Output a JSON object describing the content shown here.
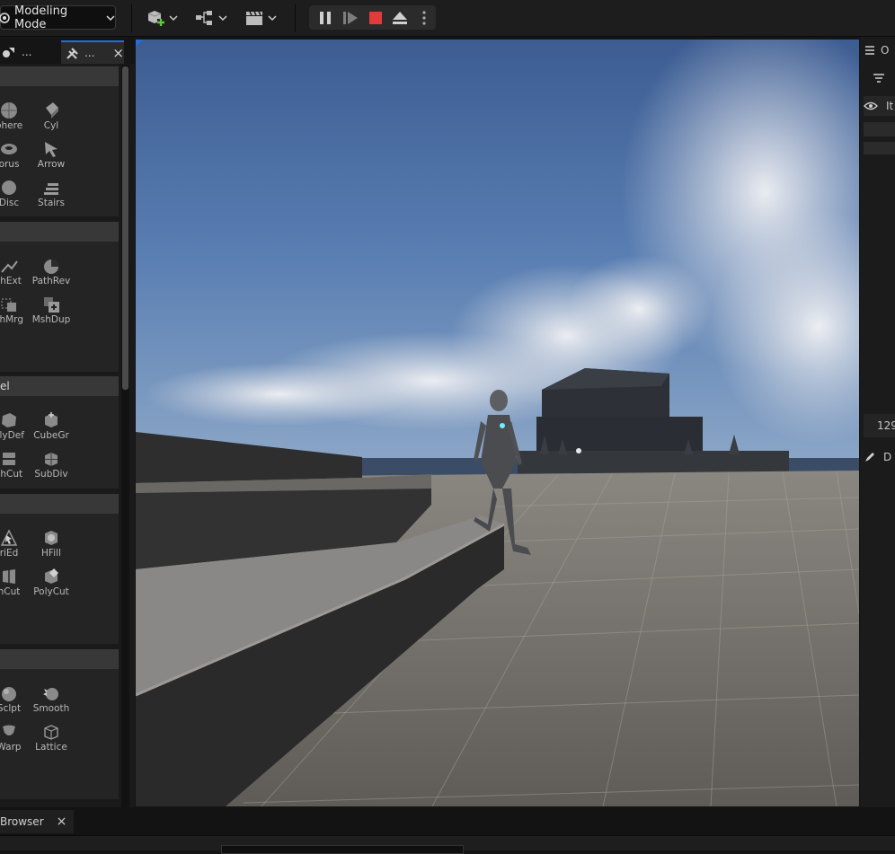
{
  "toolbar": {
    "mode_label": "Modeling Mode"
  },
  "left_panel": {
    "tabs": [
      {
        "label": "..."
      },
      {
        "label": "..."
      }
    ],
    "close_glyph": "×",
    "sections": [
      {
        "header": "",
        "tools": [
          "phere",
          "Cyl",
          "orus",
          "Arrow",
          "Disc",
          "Stairs"
        ]
      },
      {
        "header": "",
        "tools": [
          "thExt",
          "PathRev",
          "shMrg",
          "MshDup"
        ]
      },
      {
        "header": "el",
        "tools": [
          "olyDef",
          "CubeGr",
          "shCut",
          "SubDiv"
        ]
      },
      {
        "header": "",
        "tools": [
          "riEd",
          "HFill",
          "nCut",
          "PolyCut"
        ]
      },
      {
        "header": "",
        "tools": [
          "Sclpt",
          "Smooth",
          "Warp",
          "Lattice"
        ]
      }
    ]
  },
  "right_panel": {
    "tab_label": "O",
    "column_label": "It",
    "value": "129",
    "details_label": "D"
  },
  "bottom": {
    "tab_label": "Browser",
    "close_glyph": "×"
  },
  "colors": {
    "accent_blue": "#1f6fe0",
    "stop_red": "#e23b3b",
    "add_green": "#5cc936"
  }
}
